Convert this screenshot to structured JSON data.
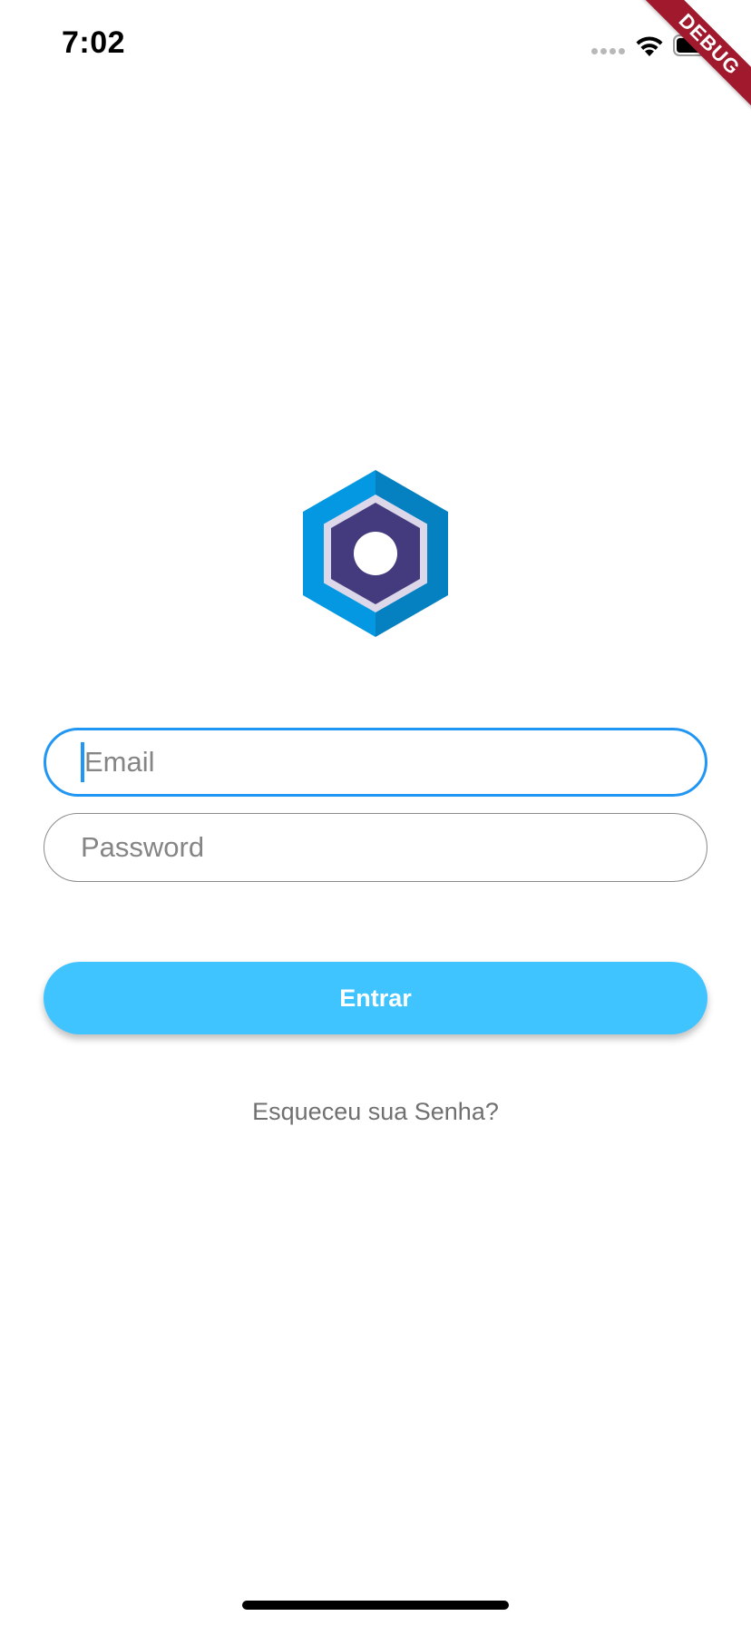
{
  "status_bar": {
    "time": "7:02",
    "wifi_icon": "wifi-icon",
    "battery_icon": "battery-icon"
  },
  "debug_banner": {
    "label": "DEBUG",
    "color": "#a0192d"
  },
  "logo": {
    "icon": "hexagon-logo-icon",
    "colors": {
      "outer_light": "#0598e2",
      "outer_dark": "#0581c2",
      "inner": "#443a7e",
      "ring": "#dcd8ea"
    }
  },
  "login_form": {
    "email": {
      "placeholder": "Email",
      "value": ""
    },
    "password": {
      "placeholder": "Password",
      "value": ""
    },
    "submit_label": "Entrar",
    "forgot_password_label": "Esqueceu sua Senha?"
  },
  "colors": {
    "focus_border": "#2196f3",
    "button_background": "#40c4ff",
    "button_text": "#ffffff",
    "link_text": "#707070"
  }
}
